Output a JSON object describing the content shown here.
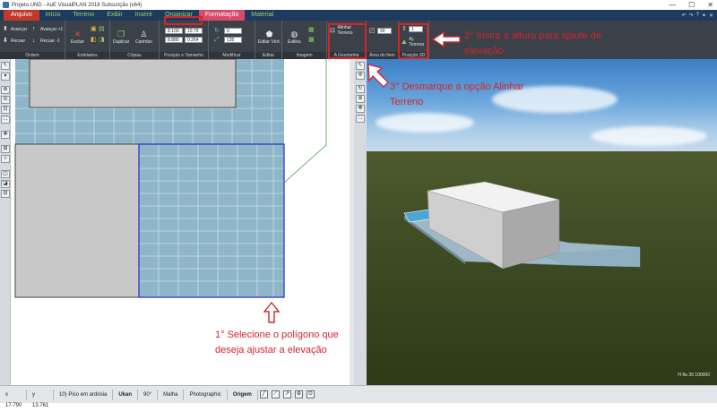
{
  "window": {
    "title": "Projeto.UND - AuE VisualPLAN 2018 Subscrição (x64)",
    "controls": [
      "—",
      "☐",
      "✕"
    ]
  },
  "menu": {
    "items": [
      "Arquivo",
      "Início",
      "Terreno",
      "Exibir",
      "Inserir",
      "Organizar",
      "Formatação",
      "Material"
    ],
    "active": "Formatação",
    "right_icons": [
      "↶",
      "↷",
      "?",
      "✦",
      "✕"
    ]
  },
  "ribbon": {
    "groups": {
      "ordem": {
        "label": "Ordem",
        "buttons": [
          "Avançar",
          "Recuar",
          "Avançar +1",
          "Recuar -1"
        ]
      },
      "entidades": {
        "label": "Entidades",
        "buttons": [
          "Excluir"
        ]
      },
      "copias": {
        "label": "Cópias",
        "buttons": [
          "Duplicar",
          "Carimbo"
        ]
      },
      "posicao": {
        "label": "Posição e Tamanho",
        "values": [
          "8.103",
          "10.79",
          "8.880",
          "0.264"
        ]
      },
      "modificar": {
        "label": "Modificar",
        "values": [
          "0",
          "135"
        ]
      },
      "poligono": {
        "label": "Editar Polígono",
        "buttons": [
          "Editar Vért."
        ]
      },
      "imagem": {
        "label": "Imagem",
        "buttons": [
          "Estilos"
        ]
      },
      "geometria": {
        "label": "A Geometria",
        "buttons": [
          "Alinhar Terreno"
        ]
      },
      "area": {
        "label": "Área do Item",
        "value": "90"
      },
      "posicao3d": {
        "label": "Posição 3D",
        "value": "1",
        "buttons": [
          "Aj. Terreno"
        ]
      }
    }
  },
  "annotations": {
    "step1": "1° Selecione o polígono que deseja ajustar a elevação",
    "step2": "2° Insira a altura para ajsute de elevação",
    "step3": "3° Desmarque a opção Alinhar Terreno"
  },
  "view3d": {
    "readout": "H 8a  39  100000"
  },
  "status": {
    "x": "x 17.790",
    "y": "y 13.761",
    "unit": "10) Piso em ardósia",
    "snap": "Ukan",
    "angle": "90°",
    "mesh": "Malha",
    "render": "Photographic",
    "origin": "Origem"
  },
  "colors": {
    "menubar": "#1e3a5f",
    "menu_text": "#9ed26a",
    "active_tab": "#d84a6a",
    "annotation": "#d1262c",
    "selection": "#2a2ac8"
  }
}
